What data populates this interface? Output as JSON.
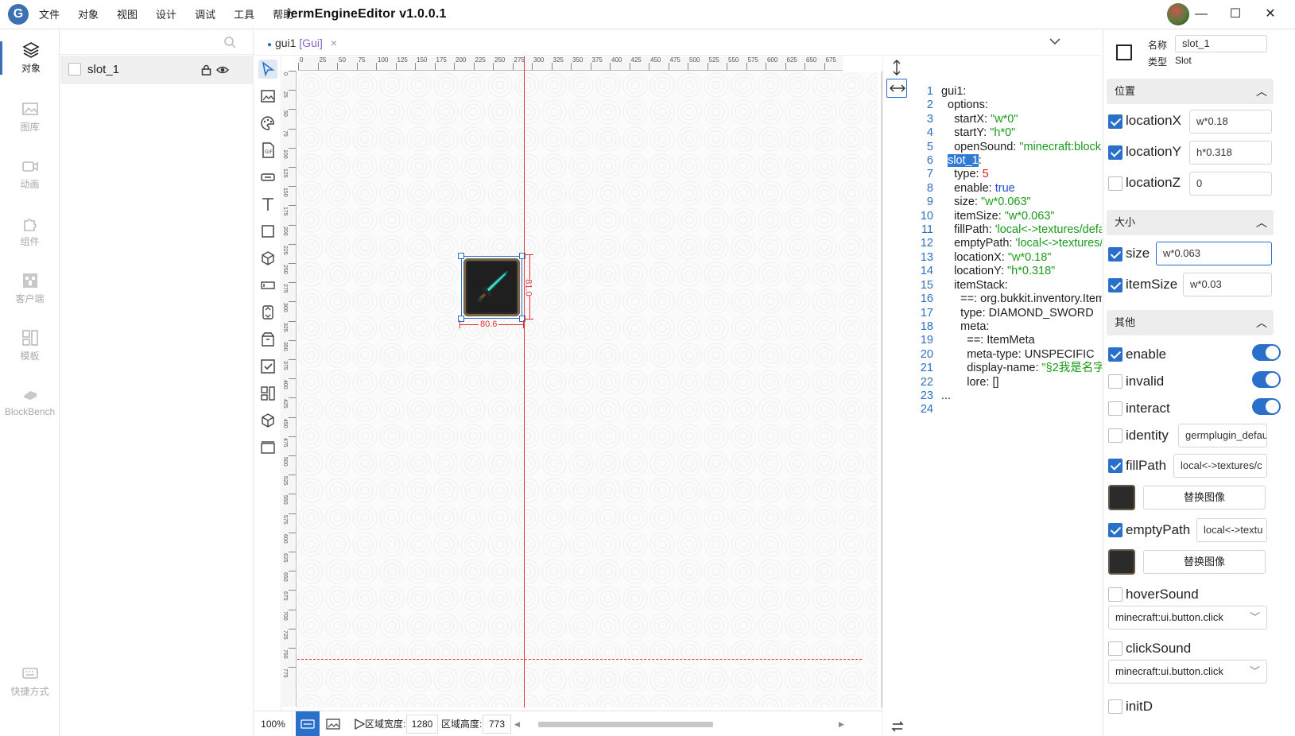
{
  "titlebar": {
    "app_title": "iermEngineEditor v1.0.0.1",
    "menus": [
      "文件",
      "对象",
      "视图",
      "设计",
      "调试",
      "工具",
      "帮助"
    ],
    "minimize": "—",
    "maximize": "☐",
    "close": "✕"
  },
  "rail": [
    "对象",
    "图库",
    "动画",
    "组件",
    "客户端",
    "模板",
    "BlockBench",
    "快捷方式"
  ],
  "objects": {
    "search_placeholder": "",
    "items": [
      {
        "name": "slot_1"
      }
    ]
  },
  "tab": {
    "name": "gui1",
    "type": "[Gui]",
    "close": "×"
  },
  "ruler": {
    "h_ticks": [
      "0",
      "25",
      "50",
      "75",
      "100",
      "125",
      "150",
      "175",
      "200",
      "225",
      "250",
      "275",
      "300",
      "325",
      "350",
      "375",
      "400",
      "425",
      "450",
      "475",
      "500",
      "525",
      "550",
      "575",
      "600",
      "625",
      "650",
      "675",
      "700",
      "725"
    ],
    "v_ticks": [
      "0",
      "25",
      "50",
      "75",
      "100",
      "125",
      "150",
      "175",
      "200",
      "225",
      "250",
      "275",
      "300",
      "325",
      "350",
      "375",
      "400",
      "425",
      "450",
      "475",
      "500",
      "525",
      "550",
      "575",
      "600",
      "625",
      "650",
      "675",
      "700",
      "725",
      "750",
      "775"
    ]
  },
  "canvas": {
    "width_dim": "80.6",
    "height_dim": "81.0"
  },
  "bottom": {
    "zoom": "100%",
    "area_width_label": "区域宽度:",
    "area_width": "1280",
    "area_height_label": "区域高度:",
    "area_height": "773"
  },
  "code_lines": [
    "1",
    "2",
    "3",
    "4",
    "5",
    "6",
    "7",
    "8",
    "9",
    "10",
    "11",
    "12",
    "13",
    "14",
    "15",
    "16",
    "17",
    "18",
    "19",
    "20",
    "21",
    "22",
    "23",
    "24"
  ],
  "props": {
    "name_label": "名称",
    "name_value": "slot_1",
    "type_label": "类型",
    "type_value": "Slot",
    "sec_position": "位置",
    "sec_size": "大小",
    "sec_other": "其他",
    "locationX": {
      "label": "locationX",
      "value": "w*0.18",
      "checked": true
    },
    "locationY": {
      "label": "locationY",
      "value": "h*0.318",
      "checked": true
    },
    "locationZ": {
      "label": "locationZ",
      "value": "0",
      "checked": false
    },
    "size": {
      "label": "size",
      "value": "w*0.063",
      "checked": true
    },
    "itemSize": {
      "label": "itemSize",
      "value": "w*0.03",
      "checked": true
    },
    "enable": {
      "label": "enable",
      "checked": true,
      "toggle": true
    },
    "invalid": {
      "label": "invalid",
      "checked": false,
      "toggle": true
    },
    "interact": {
      "label": "interact",
      "checked": false,
      "toggle": true
    },
    "identity": {
      "label": "identity",
      "value": "germplugin_defau",
      "checked": false
    },
    "fillPath": {
      "label": "fillPath",
      "value": "local<->textures/c",
      "checked": true
    },
    "emptyPath": {
      "label": "emptyPath",
      "value": "local<->textu",
      "checked": true
    },
    "replace_image": "替换图像",
    "hoverSound": {
      "label": "hoverSound",
      "value": "minecraft:ui.button.click",
      "checked": false
    },
    "clickSound": {
      "label": "clickSound",
      "value": "minecraft:ui.button.click",
      "checked": false
    },
    "last_label": "initD"
  },
  "colors": {
    "accent": "#2a6fc9",
    "guide": "#e03030",
    "code_string": "#1a9a1a",
    "code_number": "#d02020",
    "code_keyword": "#1f4fd0"
  }
}
